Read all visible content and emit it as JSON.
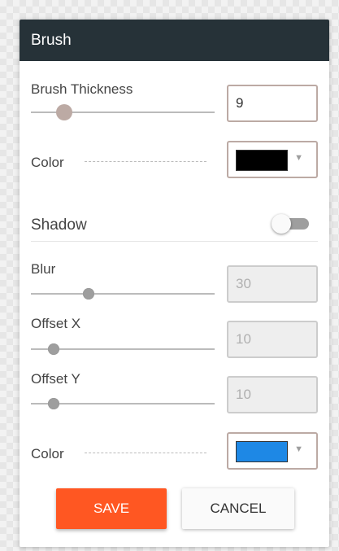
{
  "dialog": {
    "title": "Brush",
    "brush_thickness": {
      "label": "Brush Thickness",
      "value": "9",
      "slider_fraction": 0.15
    },
    "color": {
      "label": "Color",
      "value": "#000000"
    },
    "shadow": {
      "label": "Shadow",
      "enabled": false,
      "blur": {
        "label": "Blur",
        "value": "30",
        "slider_fraction": 0.3
      },
      "offset_x": {
        "label": "Offset X",
        "value": "10",
        "slider_fraction": 0.1
      },
      "offset_y": {
        "label": "Offset Y",
        "value": "10",
        "slider_fraction": 0.1
      },
      "color": {
        "label": "Color",
        "value": "#1e88e5"
      }
    },
    "buttons": {
      "save": "SAVE",
      "cancel": "CANCEL"
    }
  },
  "icons": {
    "dropdown": "triangle-down-icon"
  }
}
